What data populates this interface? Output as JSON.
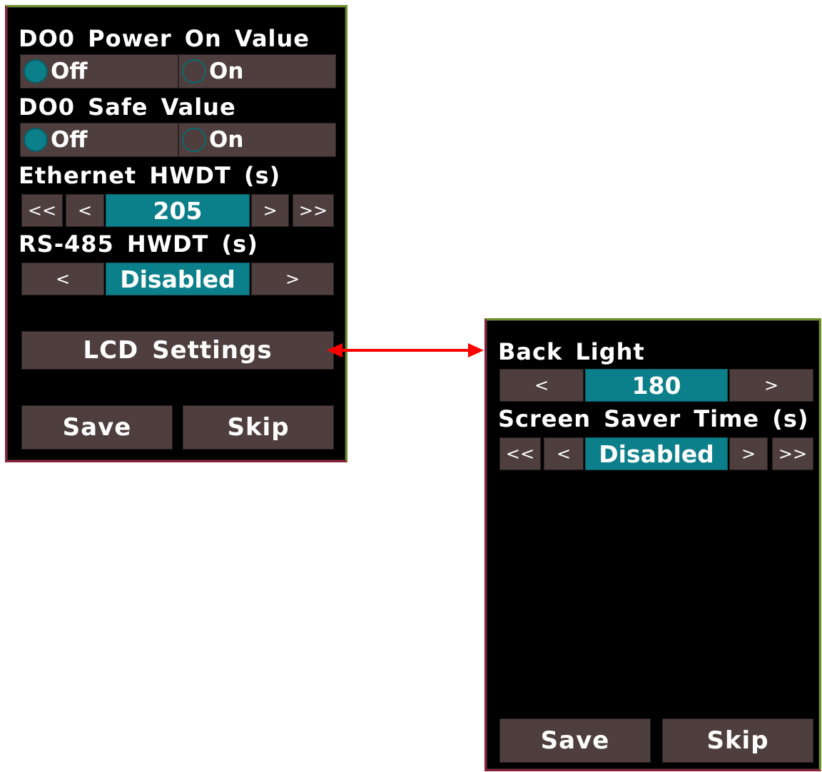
{
  "main": {
    "do0_power_on": {
      "label": "DO0 Power On Value",
      "options": [
        "Off",
        "On"
      ],
      "selected": "Off"
    },
    "do0_safe": {
      "label": "DO0 Safe Value",
      "options": [
        "Off",
        "On"
      ],
      "selected": "Off"
    },
    "eth_hwdt": {
      "label": "Ethernet HWDT (s)",
      "first": "<<",
      "prev": "<",
      "value": "205",
      "next": ">",
      "last": ">>"
    },
    "rs485_hwdt": {
      "label": "RS-485 HWDT (s)",
      "prev": "<",
      "value": "Disabled",
      "next": ">"
    },
    "lcd_settings_label": "LCD Settings",
    "save_label": "Save",
    "skip_label": "Skip"
  },
  "lcd": {
    "back_light": {
      "label": "Back Light",
      "prev": "<",
      "value": "180",
      "next": ">"
    },
    "screen_saver": {
      "label": "Screen Saver Time (s)",
      "first": "<<",
      "prev": "<",
      "value": "Disabled",
      "next": ">",
      "last": ">>"
    },
    "save_label": "Save",
    "skip_label": "Skip"
  },
  "colors": {
    "screen_bg": "#000000",
    "button_bg": "#4e3f3e",
    "value_bg": "#0b7f8a",
    "link_arrow": "#ff0000"
  }
}
